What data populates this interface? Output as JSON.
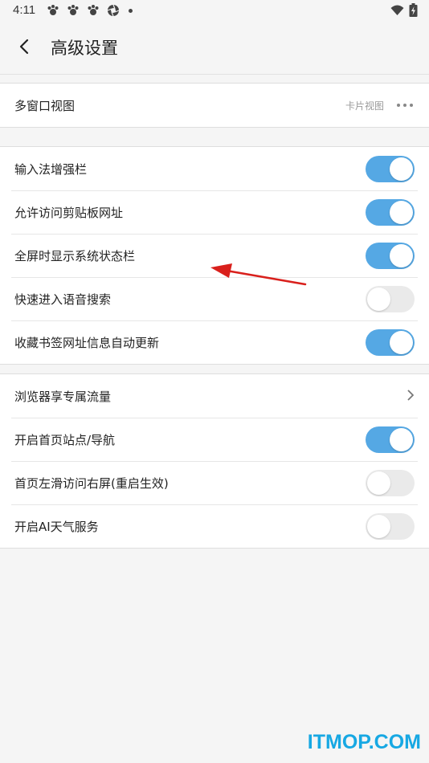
{
  "status_bar": {
    "time": "4:11",
    "notification_icons": [
      "paw-icon",
      "paw-icon",
      "paw-icon",
      "aperture-icon"
    ],
    "signal_icon": "wifi-icon",
    "battery_icon": "battery-charging-icon"
  },
  "header": {
    "back_icon": "chevron-left-icon",
    "title": "高级设置"
  },
  "groups": {
    "view": {
      "label": "多窗口视图",
      "value": "卡片视图",
      "menu_icon": "more-horizontal-icon"
    },
    "toggles": [
      {
        "label": "输入法增强栏",
        "on": true
      },
      {
        "label": "允许访问剪贴板网址",
        "on": true
      },
      {
        "label": "全屏时显示系统状态栏",
        "on": true
      },
      {
        "label": "快速进入语音搜索",
        "on": false
      },
      {
        "label": "收藏书签网址信息自动更新",
        "on": true
      }
    ],
    "misc": [
      {
        "label": "浏览器享专属流量",
        "type": "link"
      },
      {
        "label": "开启首页站点/导航",
        "type": "toggle",
        "on": true
      },
      {
        "label": "首页左滑访问右屏(重启生效)",
        "type": "toggle",
        "on": false
      },
      {
        "label": "开启AI天气服务",
        "type": "toggle",
        "on": false
      }
    ]
  },
  "annotation": {
    "icon": "red-arrow-icon",
    "color": "#d9201c"
  },
  "watermark": {
    "text": "ITMOP.COM",
    "color": "#17a8e3"
  },
  "colors": {
    "toggle_on": "#55a8e4",
    "toggle_off": "#eaeaea",
    "background": "#f5f5f5"
  }
}
